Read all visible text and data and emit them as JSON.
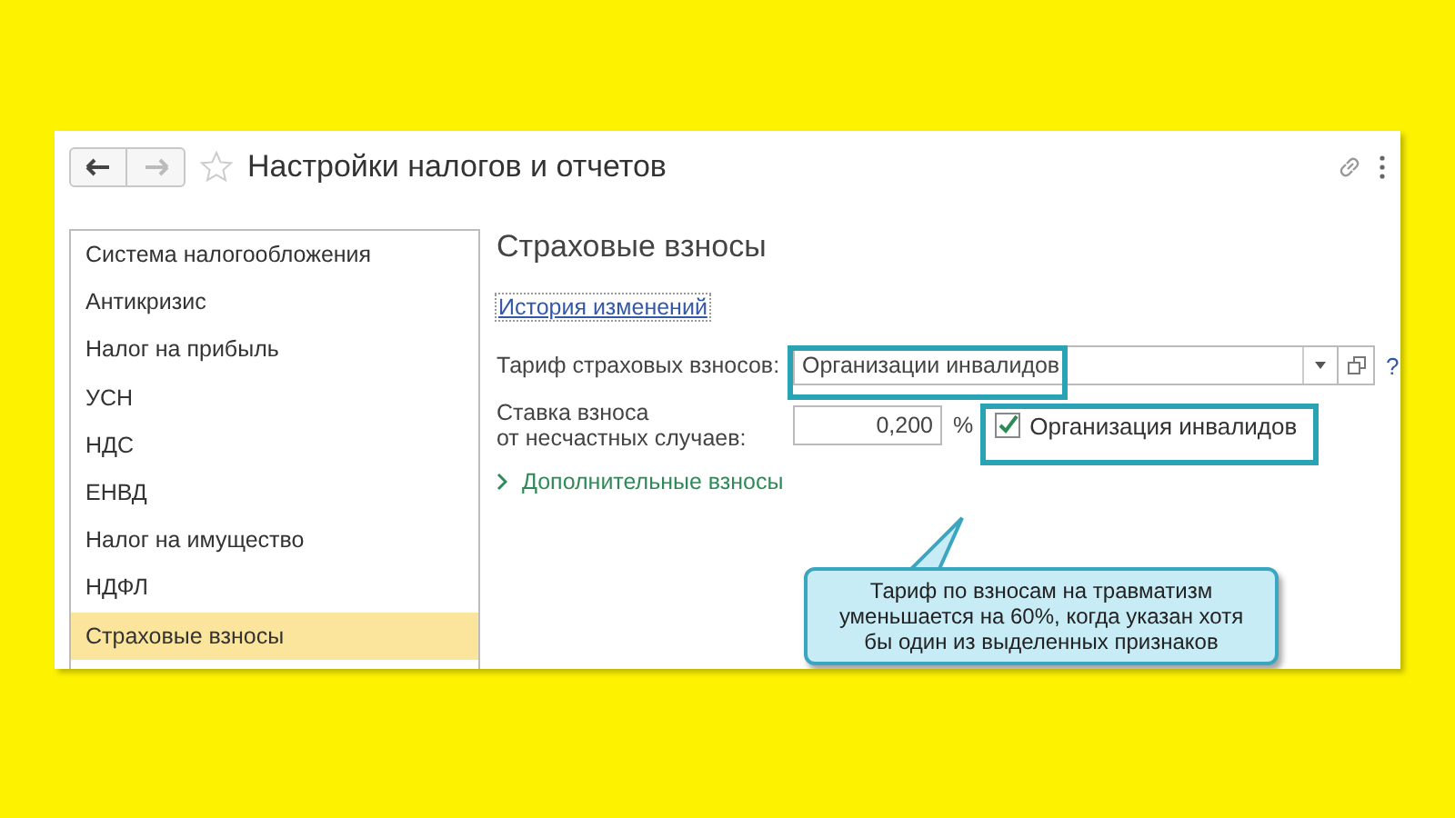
{
  "window": {
    "title": "Настройки налогов и отчетов"
  },
  "sidebar": {
    "items": [
      {
        "label": "Система налогообложения",
        "selected": false
      },
      {
        "label": "Антикризис",
        "selected": false
      },
      {
        "label": "Налог на прибыль",
        "selected": false
      },
      {
        "label": "УСН",
        "selected": false
      },
      {
        "label": "НДС",
        "selected": false
      },
      {
        "label": "ЕНВД",
        "selected": false
      },
      {
        "label": "Налог на имущество",
        "selected": false
      },
      {
        "label": "НДФЛ",
        "selected": false
      },
      {
        "label": "Страховые взносы",
        "selected": true
      }
    ]
  },
  "section": {
    "title": "Страховые взносы",
    "history_link": "История изменений",
    "tariff": {
      "label": "Тариф страховых взносов:",
      "value": "Организации инвалидов",
      "help": "?"
    },
    "rate": {
      "label_lines": [
        "Ставка взноса",
        "от несчастных случаев:"
      ],
      "value": "0,200",
      "unit": "%"
    },
    "disabled_org": {
      "label": "Организация инвалидов",
      "checked": true
    },
    "extra": {
      "label": "Дополнительные взносы",
      "expanded": false
    }
  },
  "callout": {
    "text": "Тариф по взносам на травматизм уменьшается на 60%, когда указан хотя бы один из выделенных признаков"
  }
}
